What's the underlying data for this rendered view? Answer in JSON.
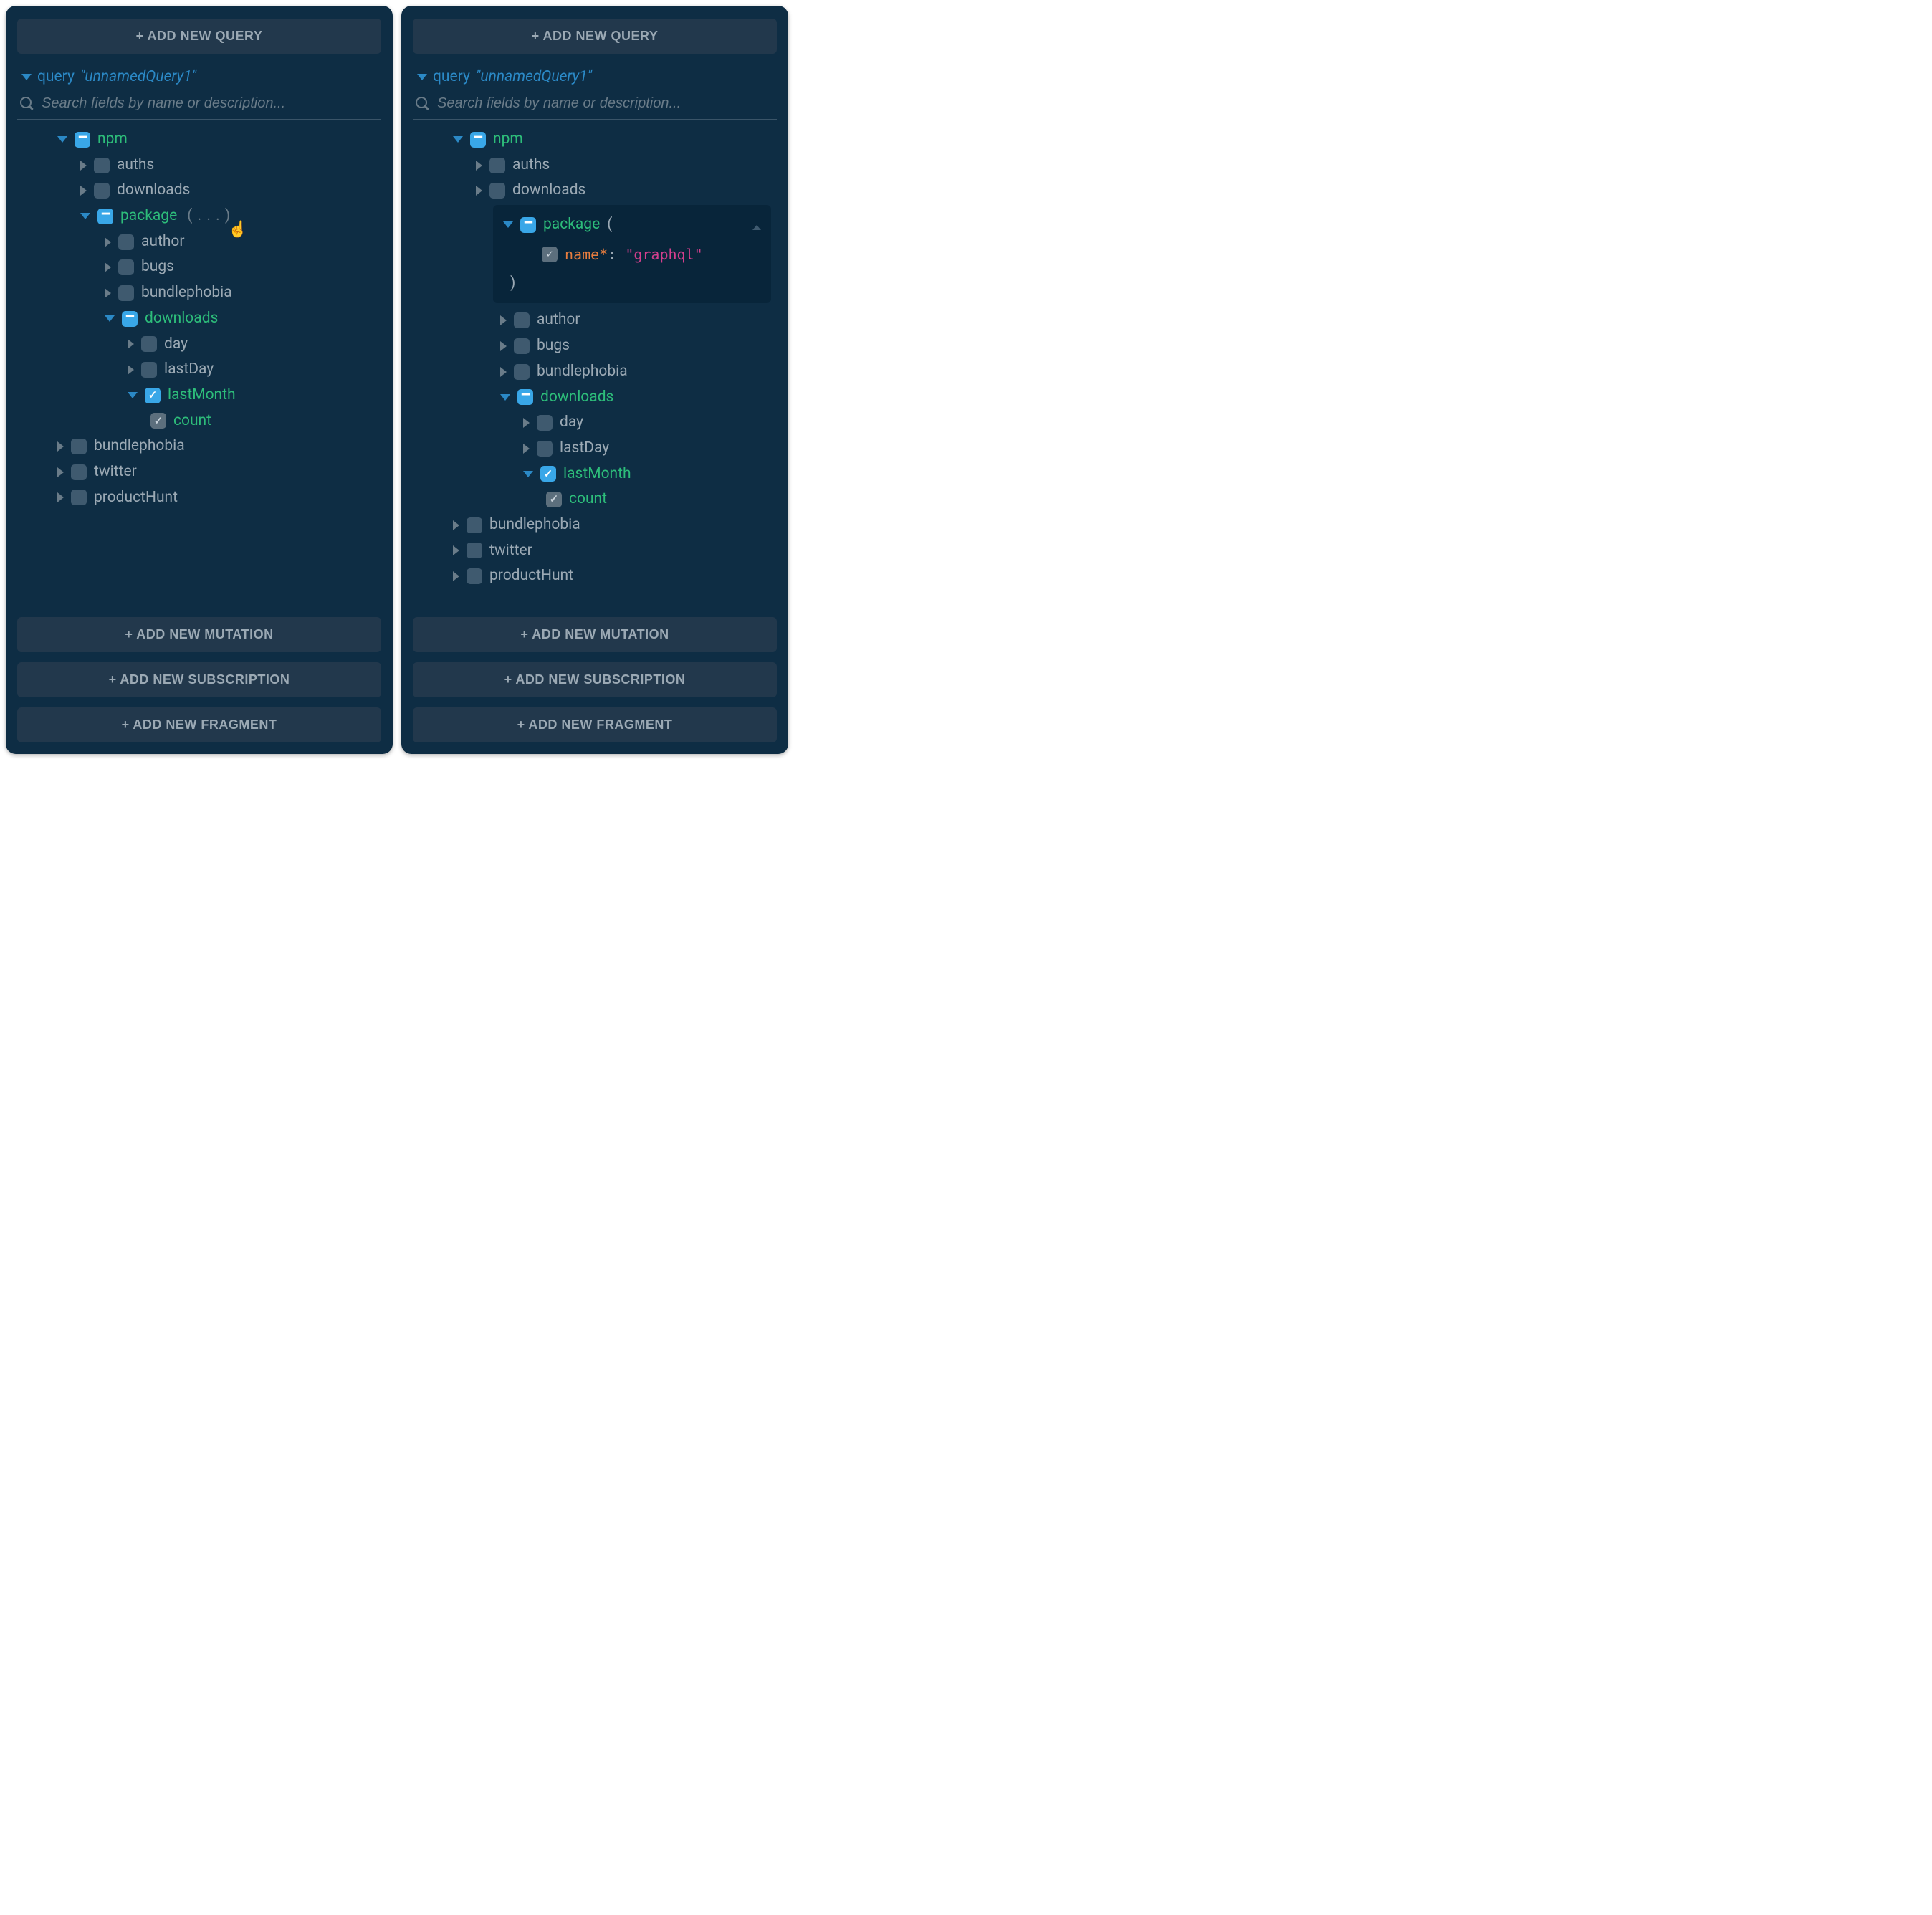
{
  "buttons": {
    "addQuery": "+ ADD NEW QUERY",
    "addMutation": "+ ADD NEW MUTATION",
    "addSubscription": "+ ADD NEW SUBSCRIPTION",
    "addFragment": "+ ADD NEW FRAGMENT"
  },
  "queryHeader": {
    "keyword": "query",
    "name": "\"unnamedQuery1\""
  },
  "search": {
    "placeholder": "Search fields by name or description..."
  },
  "fields": {
    "npm": "npm",
    "auths": "auths",
    "downloads": "downloads",
    "package": "package",
    "packageArgsCollapsed": "( . . . )",
    "author": "author",
    "bugs": "bugs",
    "bundlephobia": "bundlephobia",
    "day": "day",
    "lastDay": "lastDay",
    "lastMonth": "lastMonth",
    "count": "count",
    "twitter": "twitter",
    "productHunt": "productHunt",
    "openParen": "(",
    "closeParen": ")"
  },
  "packageArg": {
    "name": "name*",
    "colon": ":",
    "value": "\"graphql\""
  }
}
